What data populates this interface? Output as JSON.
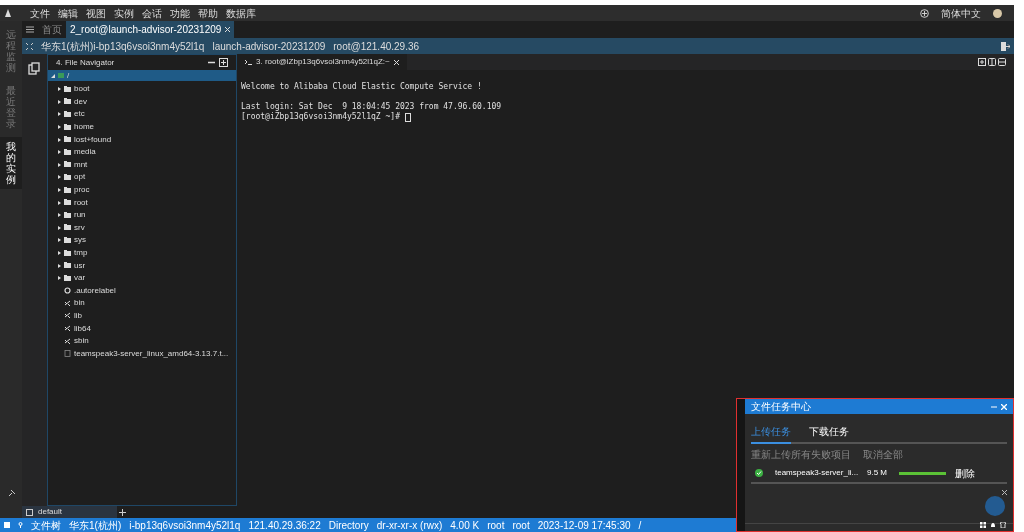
{
  "menu": [
    "文件",
    "编辑",
    "视图",
    "实例",
    "会话",
    "功能",
    "帮助",
    "数据库"
  ],
  "language": "简体中文",
  "side_tabs": [
    {
      "label": "远程监测",
      "selected": false
    },
    {
      "label": "最近登录",
      "selected": false
    },
    {
      "label": "我的实例",
      "selected": true
    }
  ],
  "tabs": [
    {
      "label": "首页",
      "selected": false,
      "closable": false
    },
    {
      "label": "2_root@launch-advisor-20231209",
      "selected": true,
      "closable": true
    }
  ],
  "session_bar": {
    "region": "华东1(杭州)i-bp13q6vsoi3nm4y52l1q",
    "host": "launch-advisor-20231209",
    "address": "root@121.40.29.36"
  },
  "file_navigator": {
    "title": "4. File Navigator",
    "root": "/",
    "items": [
      {
        "name": "boot",
        "kind": "folder"
      },
      {
        "name": "dev",
        "kind": "folder"
      },
      {
        "name": "etc",
        "kind": "folder"
      },
      {
        "name": "home",
        "kind": "folder"
      },
      {
        "name": "lost+found",
        "kind": "folder"
      },
      {
        "name": "media",
        "kind": "folder"
      },
      {
        "name": "mnt",
        "kind": "folder"
      },
      {
        "name": "opt",
        "kind": "folder"
      },
      {
        "name": "proc",
        "kind": "folder"
      },
      {
        "name": "root",
        "kind": "folder"
      },
      {
        "name": "run",
        "kind": "folder"
      },
      {
        "name": "srv",
        "kind": "folder"
      },
      {
        "name": "sys",
        "kind": "folder"
      },
      {
        "name": "tmp",
        "kind": "folder"
      },
      {
        "name": "usr",
        "kind": "folder"
      },
      {
        "name": "var",
        "kind": "folder"
      },
      {
        "name": ".autorelabel",
        "kind": "file"
      },
      {
        "name": "bin",
        "kind": "link"
      },
      {
        "name": "lib",
        "kind": "link"
      },
      {
        "name": "lib64",
        "kind": "link"
      },
      {
        "name": "sbin",
        "kind": "link"
      },
      {
        "name": "teamspeak3-server_linux_amd64-3.13.7.t...",
        "kind": "archive"
      }
    ]
  },
  "terminal": {
    "tab": "3. root@iZbp13q6vsoi3nm4y52l1qZ:~",
    "banner": "Welcome to Alibaba Cloud Elastic Compute Service !",
    "lines": [
      "Last login: Sat Dec  9 18:04:45 2023 from 47.96.60.109",
      "[root@iZbp13q6vsoi3nm4y52l1qZ ~]# "
    ]
  },
  "bottom_tab": "default",
  "status_bar": [
    "文件树",
    "华东1(杭州)",
    "i-bp13q6vsoi3nm4y52l1q",
    "121.40.29.36:22",
    "Directory",
    "dr-xr-xr-x (rwx)",
    "4.00 K",
    "root",
    "root",
    "2023-12-09 17:45:30",
    "/"
  ],
  "task_center": {
    "title": "文件任务中心",
    "tabs": [
      {
        "label": "上传任务",
        "selected": true
      },
      {
        "label": "下载任务",
        "selected": false
      }
    ],
    "actions": [
      "重新上传所有失败项目",
      "取消全部"
    ],
    "tasks": [
      {
        "name": "teamspeak3-server_li...",
        "size": "9.5 M",
        "level": 1,
        "action": "删除"
      }
    ]
  }
}
